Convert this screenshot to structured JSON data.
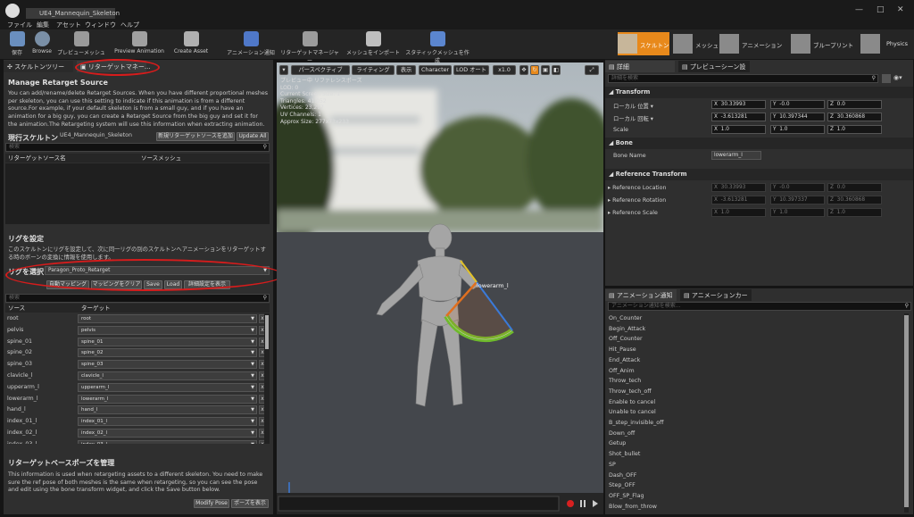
{
  "window": {
    "tab_title": "UE4_Mannequin_Skeleton"
  },
  "menu": [
    "ファイル",
    "編集",
    "アセット",
    "ウィンドウ",
    "ヘルプ"
  ],
  "toolbar": [
    {
      "label": "保存",
      "icon": "save-icon"
    },
    {
      "label": "Browse",
      "icon": "browse-icon"
    },
    {
      "label": "プレビューメッシュ",
      "icon": "preview-mesh-icon"
    },
    {
      "label": "Preview Animation",
      "icon": "preview-animation-icon"
    },
    {
      "label": "Create Asset",
      "icon": "create-asset-icon"
    },
    {
      "label": "アニメーション通知",
      "icon": "anim-notify-icon"
    },
    {
      "label": "リターゲットマネージャー",
      "icon": "retarget-manager-icon"
    },
    {
      "label": "メッシュをインポート",
      "icon": "import-mesh-icon"
    },
    {
      "label": "スタティックメッシュを作成",
      "icon": "static-mesh-icon"
    }
  ],
  "modes": [
    "スケルトン",
    "メッシュ",
    "アニメーション",
    "ブループリント",
    "Physics"
  ],
  "left": {
    "tabs": [
      "スケルトンツリー",
      "リターゲットマネー..."
    ],
    "manage_title": "Manage Retarget Source",
    "manage_desc": "You can add/rename/delete Retarget Sources. When you have different proportional meshes per skeleton, you can use this setting to indicate if this animation is from a different source.For example, if your default skeleton is from a small guy, and if you have an animation for a big guy, you can create a Retarget Source from the big guy and set it for the animation.The Retargeting system will use this information when extracting animation.",
    "current_skeleton_label": "現行スケルトン",
    "current_skeleton_value": "UE4_Mannequin_Skeleton",
    "new_source_btn": "新規リターゲットソースを追加",
    "update_all_btn": "Update All",
    "search_placeholder": "検索",
    "col_source": "リターゲットソース名",
    "col_mesh": "ソースメッシュ",
    "rig_title": "リグを設定",
    "rig_desc": "このスケルトンにリグを設定して、次に同一リグの別のスケルトンへアニメーションをリターゲットする時のボーンの変換に情報を使用します。",
    "rig_select_label": "リグを選択",
    "rig_select_value": "Paragon_Proto_Retarget",
    "buttons": [
      "自動マッピング",
      "マッピングをクリア",
      "Save",
      "Load",
      "詳細設定を表示"
    ],
    "map_search_placeholder": "検索",
    "map_col_source": "ソース",
    "map_col_target": "ターゲット",
    "mappings": [
      {
        "source": "root",
        "target": "root"
      },
      {
        "source": "pelvis",
        "target": "pelvis"
      },
      {
        "source": "spine_01",
        "target": "spine_01"
      },
      {
        "source": "spine_02",
        "target": "spine_02"
      },
      {
        "source": "spine_03",
        "target": "spine_03"
      },
      {
        "source": "clavicle_l",
        "target": "clavicle_l"
      },
      {
        "source": "upperarm_l",
        "target": "upperarm_l"
      },
      {
        "source": "lowerarm_l",
        "target": "lowerarm_l"
      },
      {
        "source": "hand_l",
        "target": "hand_l"
      },
      {
        "source": "index_01_l",
        "target": "index_01_l"
      },
      {
        "source": "index_02_l",
        "target": "index_02_l"
      },
      {
        "source": "index_03_l",
        "target": "index_03_l"
      }
    ],
    "remove_label": "x",
    "pose_title": "リターゲットベースポーズを管理",
    "pose_desc": "This information is used when retargeting assets to a different skeleton. You need to make sure the ref pose of both meshes is the same when retargeting, so you can see the pose and edit using the bone transform widget, and click the Save button below.",
    "modify_pose_btn": "Modify Pose",
    "view_pose_btn": "ポーズを表示"
  },
  "viewport": {
    "buttons": [
      "パースペクティブ",
      "ライティング",
      "表示",
      "Character",
      "LOD オート",
      "x1.0"
    ],
    "stats": [
      "プレビュー中 リファレンスポーズ",
      "LOD: 0",
      "Current Screen Size: 1",
      "Triangles: 41,052",
      "Vertices: 23,297",
      "UV Channels: 1",
      "Approx Size: 277x73x233"
    ],
    "bone_label": "lowerarm_l"
  },
  "details": {
    "tabs": [
      "詳細",
      "プレビューシーン設"
    ],
    "search_placeholder": "詳細を検索",
    "transform_title": "Transform",
    "location_label": "ローカル 位置",
    "rotation_label": "ローカル 回転",
    "scale_label": "Scale",
    "location": [
      "30.33993",
      "-0.0",
      "0.0"
    ],
    "rotation": [
      "-3.613281",
      "10.397344",
      "30.360868"
    ],
    "scale": [
      "1.0",
      "1.0",
      "1.0"
    ],
    "bone_title": "Bone",
    "bone_name_label": "Bone Name",
    "bone_name_value": "lowerarm_l",
    "ref_title": "Reference Transform",
    "ref_location_label": "Reference Location",
    "ref_rotation_label": "Reference Rotation",
    "ref_scale_label": "Reference Scale",
    "ref_location": [
      "30.33993",
      "-0.0",
      "0.0"
    ],
    "ref_rotation": [
      "-3.613281",
      "10.397337",
      "30.360868"
    ],
    "ref_scale": [
      "1.0",
      "1.0",
      "1.0"
    ],
    "axis": [
      "X",
      "Y",
      "Z"
    ]
  },
  "anim": {
    "tabs": [
      "アニメーション通知",
      "アニメーションカー"
    ],
    "search_placeholder": "アニメーション通知を検索...",
    "items": [
      "On_Counter",
      "Begin_Attack",
      "Off_Counter",
      "Hit_Pause",
      "End_Attack",
      "Off_Anim",
      "Throw_tech",
      "Throw_tech_off",
      "Enable to cancel",
      "Unable to cancel",
      "B_step_invisible_off",
      "Down_off",
      "Getup",
      "Shot_bullet",
      "SP",
      "Dash_OFF",
      "Step_OFF",
      "OFF_SP_Flag",
      "Blow_from_throw"
    ]
  },
  "colors": {
    "highlight": "#d71c1c",
    "active_mode": "#e8891b"
  }
}
